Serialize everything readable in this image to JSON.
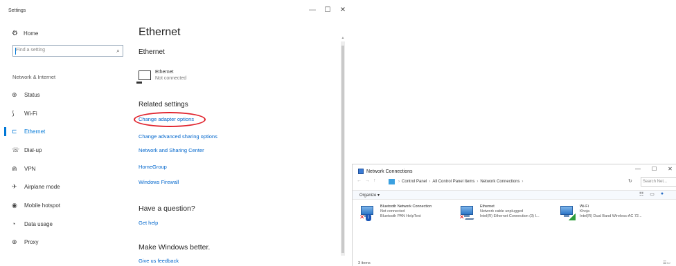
{
  "settings": {
    "title": "Settings",
    "controls": {
      "minimize": "—",
      "maximize": "☐",
      "close": "✕"
    },
    "home": {
      "label": "Home",
      "icon": "gear-icon"
    },
    "search": {
      "placeholder": "Find a setting"
    },
    "section": "Network & Internet",
    "nav": [
      {
        "label": "Status",
        "icon": "status-icon",
        "glyph": "⊕"
      },
      {
        "label": "Wi-Fi",
        "icon": "wifi-icon",
        "glyph": "⟆"
      },
      {
        "label": "Ethernet",
        "icon": "ethernet-icon",
        "glyph": "⊏"
      },
      {
        "label": "Dial-up",
        "icon": "dialup-icon",
        "glyph": "☏"
      },
      {
        "label": "VPN",
        "icon": "vpn-icon",
        "glyph": "⋒"
      },
      {
        "label": "Airplane mode",
        "icon": "airplane-icon",
        "glyph": "✈"
      },
      {
        "label": "Mobile hotspot",
        "icon": "hotspot-icon",
        "glyph": "◉"
      },
      {
        "label": "Data usage",
        "icon": "data-usage-icon",
        "glyph": "◔"
      },
      {
        "label": "Proxy",
        "icon": "globe-icon",
        "glyph": "⊕"
      }
    ],
    "page_title": "Ethernet",
    "subheading": "Ethernet",
    "adapter": {
      "name": "Ethernet",
      "status": "Not connected"
    },
    "related_heading": "Related settings",
    "related_links": [
      "Change adapter options",
      "Change advanced sharing options",
      "Network and Sharing Center",
      "HomeGroup",
      "Windows Firewall"
    ],
    "question_heading": "Have a question?",
    "get_help": "Get help",
    "better_heading": "Make Windows better.",
    "feedback": "Give us feedback",
    "accent_color": "#0078d7",
    "highlight_color": "#e0212b"
  },
  "network_connections": {
    "title": "Network Connections",
    "breadcrumbs": [
      "Control Panel",
      "All Control Panel Items",
      "Network Connections"
    ],
    "search_placeholder": "Search Net...",
    "organize": "Organize ▾",
    "connections": [
      {
        "name": "Bluetooth Network Connection",
        "status": "Not connected",
        "device": "Bluetooth PAN HelpText",
        "icon": "bluetooth-adapter-icon"
      },
      {
        "name": "Ethernet",
        "status": "Network cable unplugged",
        "device": "Intel(R) Ethernet Connection (3) I...",
        "icon": "ethernet-adapter-icon"
      },
      {
        "name": "Wi-Fi",
        "status": "Khoja",
        "device": "Intel(R) Dual Band Wireless-AC 72...",
        "icon": "wifi-adapter-icon"
      }
    ],
    "item_count": "3 items"
  }
}
